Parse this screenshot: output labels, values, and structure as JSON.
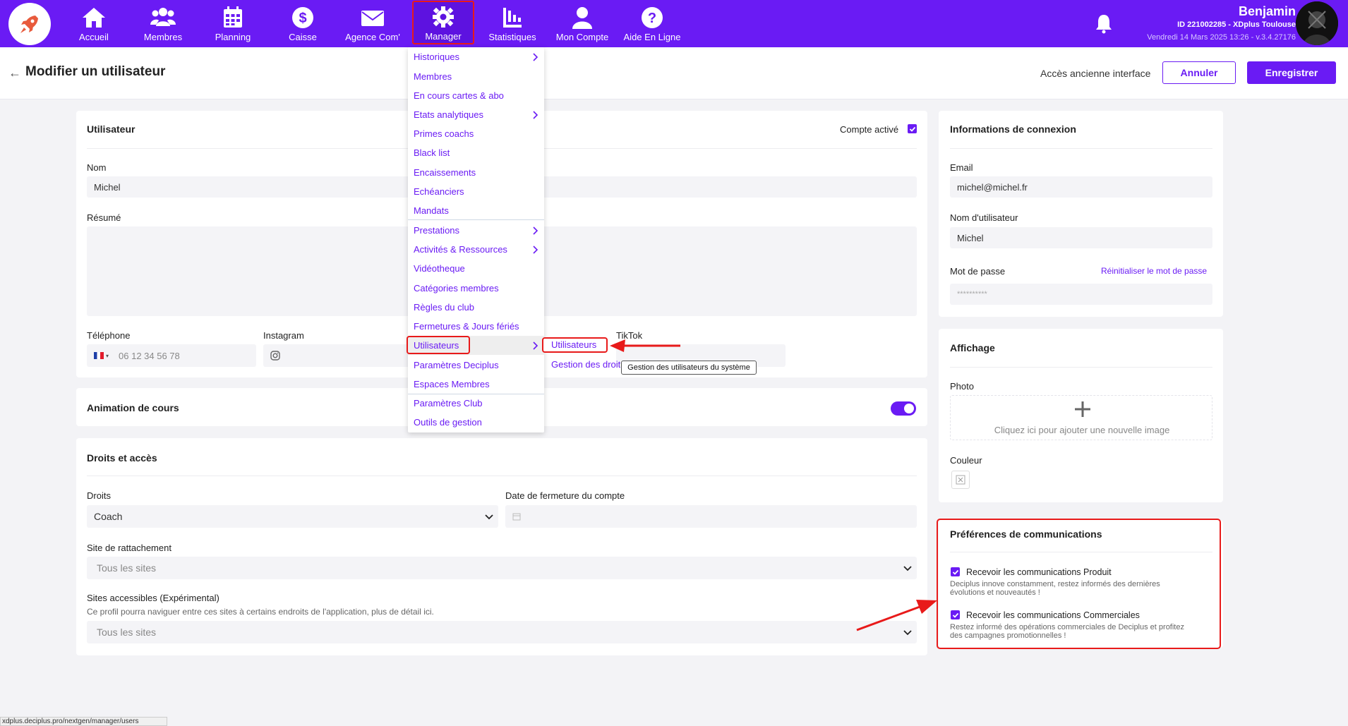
{
  "nav": {
    "items": [
      {
        "label": "Accueil",
        "icon": "home-icon"
      },
      {
        "label": "Membres",
        "icon": "members-icon"
      },
      {
        "label": "Planning",
        "icon": "calendar-icon"
      },
      {
        "label": "Caisse",
        "icon": "dollar-icon"
      },
      {
        "label": "Agence Com'",
        "icon": "mail-icon"
      },
      {
        "label": "Manager",
        "icon": "gear-icon"
      },
      {
        "label": "Statistiques",
        "icon": "stats-icon"
      },
      {
        "label": "Mon Compte",
        "icon": "user-icon"
      },
      {
        "label": "Aide En Ligne",
        "icon": "help-icon"
      }
    ],
    "active": "Manager",
    "user_name": "Benjamin",
    "user_id": "ID 221002285 - XDplus Toulouse",
    "user_date": "Vendredi 14 Mars 2025 13:26 - v.3.4.27176",
    "accent": "#6a1bf4"
  },
  "header": {
    "title": "Modifier un utilisateur",
    "legacy_link": "Accès ancienne interface",
    "cancel": "Annuler",
    "save": "Enregistrer"
  },
  "user_card": {
    "title": "Utilisateur",
    "active_label": "Compte activé",
    "active_checked": true,
    "name_label": "Nom",
    "name_value": "Michel",
    "summary_label": "Résumé",
    "phone_label": "Téléphone",
    "phone_placeholder": "06 12 34 56 78",
    "instagram_label": "Instagram",
    "tiktok_label": "TikTok"
  },
  "animation_card": {
    "title": "Animation de cours",
    "enabled": true
  },
  "rights_card": {
    "title": "Droits et accès",
    "rights_label": "Droits",
    "rights_value": "Coach",
    "closing_label": "Date de fermeture du compte",
    "site_label": "Site de rattachement",
    "site_value": "Tous les sites",
    "accessible_label": "Sites accessibles (Expérimental)",
    "accessible_help": "Ce profil pourra naviguer entre ces sites à certains endroits de l'application, plus de détail ici.",
    "accessible_value": "Tous les sites"
  },
  "login_card": {
    "title": "Informations de connexion",
    "email_label": "Email",
    "email_value": "michel@michel.fr",
    "username_label": "Nom d'utilisateur",
    "username_value": "Michel",
    "password_label": "Mot de passe",
    "reset_link": "Réinitialiser le mot de passe",
    "password_value": "**********"
  },
  "display_card": {
    "title": "Affichage",
    "photo_label": "Photo",
    "photo_hint": "Cliquez ici pour ajouter une nouvelle image",
    "color_label": "Couleur"
  },
  "comms_card": {
    "title": "Préférences de communications",
    "product_label": "Recevoir les communications Produit",
    "product_desc_1": "Deciplus innove constamment, restez informés des dernières",
    "product_desc_2": "évolutions et nouveautés !",
    "commercial_label": "Recevoir les communications Commerciales",
    "commercial_desc_1": "Restez informé des opérations commerciales de Deciplus et profitez",
    "commercial_desc_2": "des campagnes promotionnelles !"
  },
  "menu": {
    "items": [
      {
        "label": "Historiques",
        "arrow": true
      },
      {
        "label": "Membres",
        "arrow": false
      },
      {
        "label": "En cours cartes & abo",
        "arrow": false
      },
      {
        "label": "Etats analytiques",
        "arrow": true
      },
      {
        "label": "Primes coachs",
        "arrow": false
      },
      {
        "label": "Black list",
        "arrow": false
      },
      {
        "label": "Encaissements",
        "arrow": false
      },
      {
        "label": "Echéanciers",
        "arrow": false
      },
      {
        "label": "Mandats",
        "arrow": false
      },
      {
        "label": "Prestations",
        "arrow": true
      },
      {
        "label": "Activités & Ressources",
        "arrow": true
      },
      {
        "label": "Vidéotheque",
        "arrow": false
      },
      {
        "label": "Catégories membres",
        "arrow": false
      },
      {
        "label": "Règles du club",
        "arrow": false
      },
      {
        "label": "Fermetures & Jours fériés",
        "arrow": false
      },
      {
        "label": "Utilisateurs",
        "arrow": true
      },
      {
        "label": "Paramètres Deciplus",
        "arrow": false
      },
      {
        "label": "Espaces Membres",
        "arrow": false
      },
      {
        "label": "Paramètres Club",
        "arrow": false
      },
      {
        "label": "Outils de gestion",
        "arrow": false
      }
    ],
    "submenu": [
      "Utilisateurs",
      "Gestion des droits"
    ],
    "tooltip": "Gestion des utilisateurs du système"
  },
  "status_url": "xdplus.deciplus.pro/nextgen/manager/users"
}
